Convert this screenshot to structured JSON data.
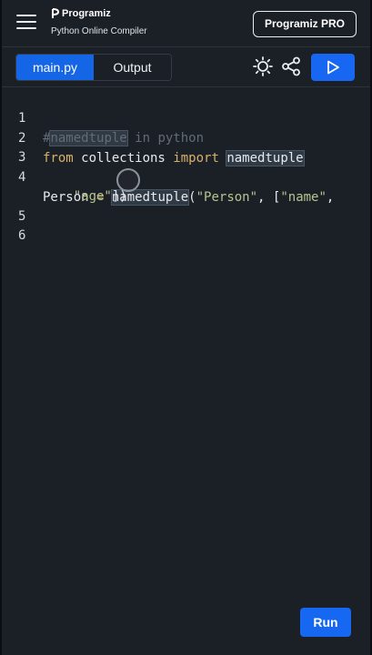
{
  "header": {
    "brand": "Programiz",
    "subtitle": "Python Online Compiler",
    "pro_button": "Programiz PRO"
  },
  "tabs": [
    {
      "label": "main.py",
      "active": true
    },
    {
      "label": "Output",
      "active": false
    }
  ],
  "toolbar": {
    "theme_icon": "sun-icon",
    "share_icon": "share-icon",
    "run_icon": "play-icon"
  },
  "editor": {
    "line_numbers": [
      "1",
      "2",
      "3",
      "4",
      "5",
      "6"
    ],
    "lines": [
      {
        "parts": [
          {
            "text": "#",
            "kind": "comment"
          },
          {
            "text": "namedtuple",
            "kind": "comment",
            "highlight": true
          },
          {
            "text": " in python",
            "kind": "comment"
          }
        ]
      },
      {
        "parts": [
          {
            "text": "from",
            "kind": "kw"
          },
          {
            "text": " collections ",
            "kind": "plain"
          },
          {
            "text": "import",
            "kind": "kw"
          },
          {
            "text": " ",
            "kind": "plain"
          },
          {
            "text": "namedtuple",
            "kind": "plain",
            "highlight": true
          }
        ]
      },
      {
        "parts": []
      },
      {
        "parts": [
          {
            "text": "Person",
            "kind": "plain"
          },
          {
            "text": " = ",
            "kind": "kw"
          },
          {
            "text": "namedtuple",
            "kind": "plain",
            "highlight": true
          },
          {
            "text": "(",
            "kind": "plain"
          },
          {
            "text": "\"Person\"",
            "kind": "str"
          },
          {
            "text": ", [",
            "kind": "plain"
          },
          {
            "text": "\"name\"",
            "kind": "str"
          },
          {
            "text": ",",
            "kind": "plain"
          }
        ]
      },
      {
        "parts": [
          {
            "text": "    ",
            "kind": "plain"
          },
          {
            "text": "\"age\"",
            "kind": "str"
          },
          {
            "text": "])",
            "kind": "plain"
          }
        ]
      },
      {
        "parts": []
      },
      {
        "parts": []
      }
    ]
  },
  "run_button": "Run",
  "colors": {
    "accent": "#1767f2",
    "background": "#1b1f26",
    "keyword": "#d6b26c",
    "string": "#b8c48f",
    "comment": "#626b76"
  }
}
